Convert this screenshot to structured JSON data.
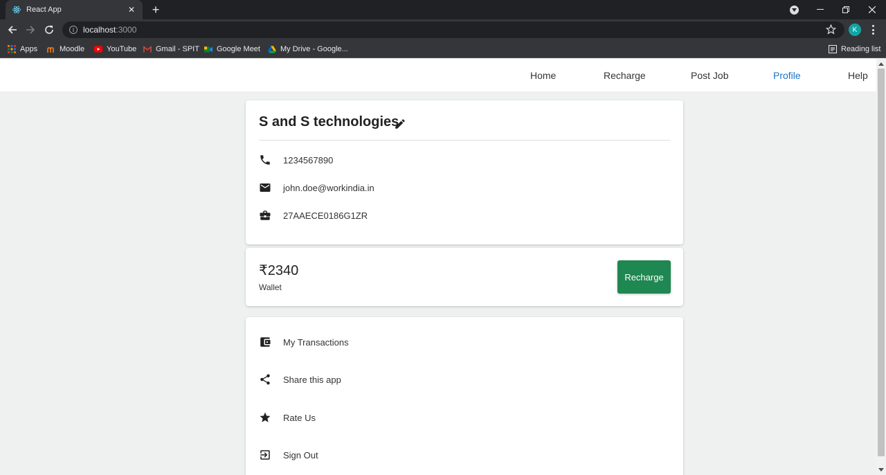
{
  "browser": {
    "tab_title": "React App",
    "url_host": "localhost",
    "url_port": ":3000",
    "profile_initial": "K",
    "bookmarks": [
      {
        "label": "Apps",
        "icon": "apps-grid-icon"
      },
      {
        "label": "Moodle",
        "icon": "moodle-icon"
      },
      {
        "label": "YouTube",
        "icon": "youtube-icon"
      },
      {
        "label": "Gmail - SPIT",
        "icon": "gmail-icon"
      },
      {
        "label": "Google Meet",
        "icon": "google-meet-icon"
      },
      {
        "label": "My Drive - Google...",
        "icon": "google-drive-icon"
      }
    ],
    "reading_list": "Reading list"
  },
  "nav": {
    "links": [
      {
        "label": "Home",
        "active": false
      },
      {
        "label": "Recharge",
        "active": false
      },
      {
        "label": "Post Job",
        "active": false
      },
      {
        "label": "Profile",
        "active": true
      },
      {
        "label": "Help",
        "active": false
      }
    ],
    "active_color": "#1a73c8"
  },
  "profile": {
    "company_name": "S and S technologies",
    "phone": "1234567890",
    "email": "john.doe@workindia.in",
    "gstin": "27AAECE0186G1ZR"
  },
  "wallet": {
    "amount": "₹2340",
    "label": "Wallet",
    "button_label": "Recharge",
    "button_color": "#1f8751"
  },
  "menu": {
    "items": [
      {
        "label": "My Transactions",
        "icon": "wallet-icon"
      },
      {
        "label": "Share this app",
        "icon": "share-icon"
      },
      {
        "label": "Rate Us",
        "icon": "star-icon"
      },
      {
        "label": "Sign Out",
        "icon": "sign-out-icon"
      }
    ]
  }
}
